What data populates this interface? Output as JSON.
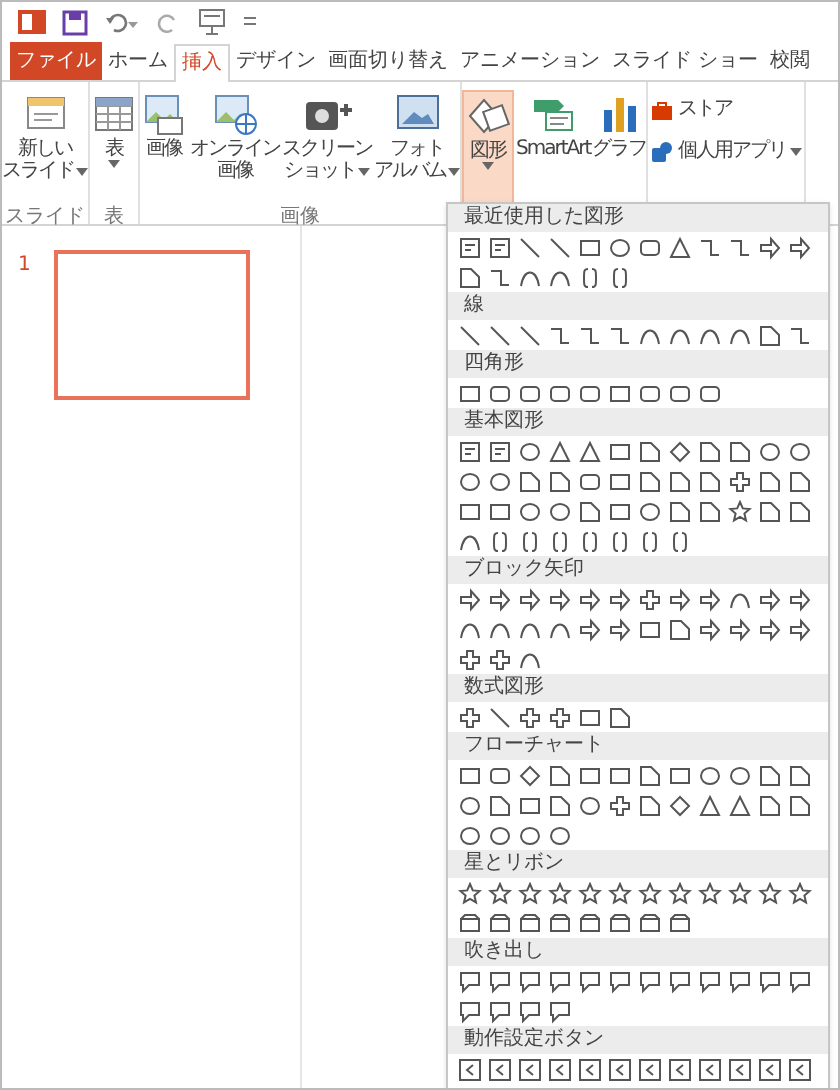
{
  "tabs": [
    {
      "label": "ファイル",
      "kind": "file",
      "selected": false
    },
    {
      "label": "ホーム",
      "kind": "tab",
      "selected": false
    },
    {
      "label": "挿入",
      "kind": "tab",
      "selected": true
    },
    {
      "label": "デザイン",
      "kind": "tab",
      "selected": false
    },
    {
      "label": "画面切り替え",
      "kind": "tab",
      "selected": false
    },
    {
      "label": "アニメーション",
      "kind": "tab",
      "selected": false
    },
    {
      "label": "スライド ショー",
      "kind": "tab",
      "selected": false
    },
    {
      "label": "校閲",
      "kind": "tab",
      "selected": false
    }
  ],
  "ribbon_groups": [
    {
      "label": "スライド",
      "buttons": [
        {
          "kind": "new_slide",
          "lines": [
            "新しい",
            "スライド"
          ],
          "has_menu": true,
          "pressed": false
        }
      ]
    },
    {
      "label": "表",
      "buttons": [
        {
          "kind": "table",
          "lines": [
            "表"
          ],
          "has_menu": true,
          "pressed": false
        }
      ]
    },
    {
      "label": "画像",
      "buttons": [
        {
          "kind": "picture",
          "lines": [
            "画像"
          ],
          "has_menu": false,
          "pressed": false
        },
        {
          "kind": "online_picture",
          "lines": [
            "オンライン",
            "画像"
          ],
          "has_menu": false,
          "pressed": false
        },
        {
          "kind": "screenshot",
          "lines": [
            "スクリーン",
            "ショット"
          ],
          "has_menu": true,
          "pressed": false
        },
        {
          "kind": "album",
          "lines": [
            "フォト",
            "アルバム"
          ],
          "has_menu": true,
          "pressed": false
        }
      ]
    },
    {
      "buttons": [
        {
          "kind": "shapes",
          "lines": [
            "図形"
          ],
          "has_menu": true,
          "pressed": true
        },
        {
          "kind": "smartart",
          "lines": [
            "SmartArt"
          ],
          "has_menu": false,
          "pressed": false
        },
        {
          "kind": "chart",
          "lines": [
            "グラフ"
          ],
          "has_menu": false,
          "pressed": false
        }
      ]
    },
    {
      "small_buttons": [
        {
          "kind": "store",
          "label": "ストア",
          "has_menu": false
        },
        {
          "kind": "apps",
          "label": "個人用アプリ",
          "has_menu": true
        }
      ]
    }
  ],
  "slide_pane": {
    "slides": [
      {
        "number": "1",
        "selected": true
      }
    ]
  },
  "shapes_gallery": {
    "sections": [
      {
        "title": "最近使用した図形"
      },
      {
        "title": "線"
      },
      {
        "title": "四角形"
      },
      {
        "title": "基本図形"
      },
      {
        "title": "ブロック矢印"
      },
      {
        "title": "数式図形"
      },
      {
        "title": "フローチャート"
      },
      {
        "title": "星とリボン"
      },
      {
        "title": "吹き出し"
      },
      {
        "title": "動作設定ボタン"
      }
    ]
  }
}
